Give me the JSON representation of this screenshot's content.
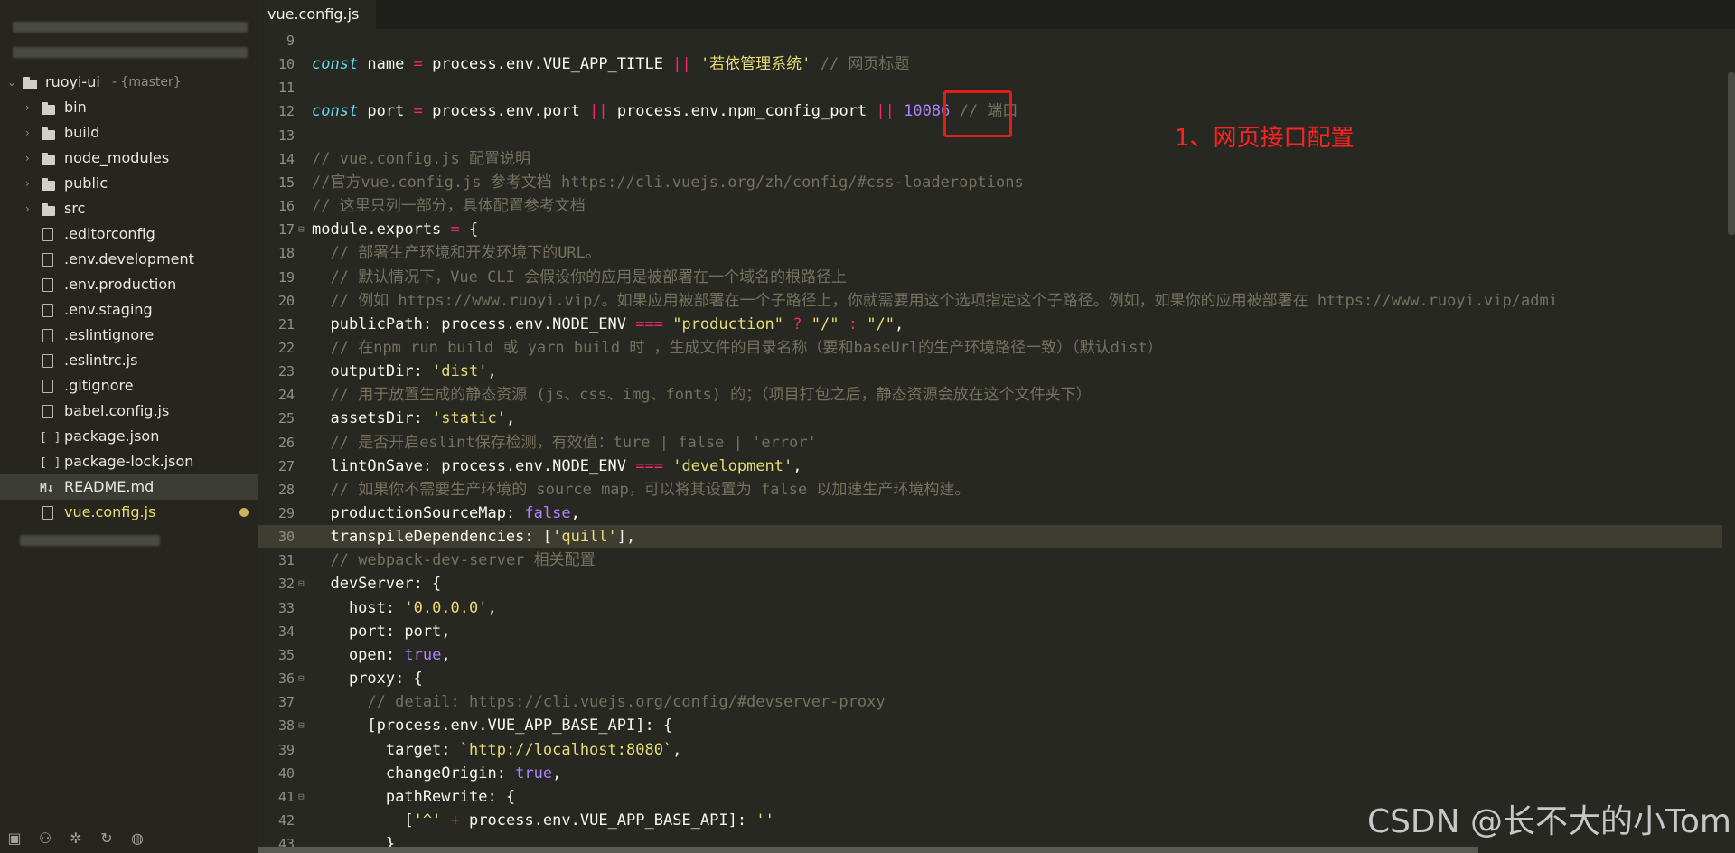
{
  "sidebar": {
    "project": {
      "name": "ruoyi-ui",
      "branch": "- {master}"
    },
    "items": [
      {
        "type": "folder",
        "label": "bin"
      },
      {
        "type": "folder",
        "label": "build"
      },
      {
        "type": "folder",
        "label": "node_modules"
      },
      {
        "type": "folder",
        "label": "public"
      },
      {
        "type": "folder",
        "label": "src"
      },
      {
        "type": "file",
        "label": ".editorconfig"
      },
      {
        "type": "file",
        "label": ".env.development"
      },
      {
        "type": "file",
        "label": ".env.production"
      },
      {
        "type": "file",
        "label": ".env.staging"
      },
      {
        "type": "file",
        "label": ".eslintignore"
      },
      {
        "type": "js",
        "label": ".eslintrc.js"
      },
      {
        "type": "file",
        "label": ".gitignore"
      },
      {
        "type": "js",
        "label": "babel.config.js"
      },
      {
        "type": "json",
        "label": "package.json"
      },
      {
        "type": "json",
        "label": "package-lock.json"
      },
      {
        "type": "md",
        "label": "README.md"
      },
      {
        "type": "js",
        "label": "vue.config.js"
      }
    ]
  },
  "tabs": [
    {
      "label": "vue.config.js"
    }
  ],
  "editor": {
    "lines": [
      {
        "n": "9",
        "html": ""
      },
      {
        "n": "10",
        "html": "<span class='kw'>const</span> name <span class='op'>=</span> process.env.VUE_APP_TITLE <span class='op'>||</span> <span class='str'>'若依管理系统'</span> <span class='cm'>// 网页标题</span>"
      },
      {
        "n": "11",
        "html": ""
      },
      {
        "n": "12",
        "html": "<span class='kw'>const</span> port <span class='op'>=</span> process.env.port <span class='op'>||</span> process.env.npm_config_port <span class='op'>||</span> <span class='num'>10086</span> <span class='cm'>// 端口</span>"
      },
      {
        "n": "13",
        "html": ""
      },
      {
        "n": "14",
        "html": "<span class='cm'>// vue.config.js 配置说明</span>"
      },
      {
        "n": "15",
        "html": "<span class='cm'>//官方vue.config.js 参考文档 https://cli.vuejs.org/zh/config/#css-loaderoptions</span>"
      },
      {
        "n": "16",
        "html": "<span class='cm'>// 这里只列一部分，具体配置参考文档</span>"
      },
      {
        "n": "17",
        "fold": true,
        "html": "module.exports <span class='op'>=</span> {"
      },
      {
        "n": "18",
        "html": "  <span class='cm'>// 部署生产环境和开发环境下的URL。</span>"
      },
      {
        "n": "19",
        "html": "  <span class='cm'>// 默认情况下，Vue CLI 会假设你的应用是被部署在一个域名的根路径上</span>"
      },
      {
        "n": "20",
        "html": "  <span class='cm'>// 例如 https://www.ruoyi.vip/。如果应用被部署在一个子路径上，你就需要用这个选项指定这个子路径。例如，如果你的应用被部署在 https://www.ruoyi.vip/admi</span>"
      },
      {
        "n": "21",
        "html": "  publicPath: process.env.NODE_ENV <span class='op'>===</span> <span class='str'>\"production\"</span> <span class='op'>?</span> <span class='str'>\"/\"</span> <span class='op'>:</span> <span class='str'>\"/\"</span>,"
      },
      {
        "n": "22",
        "html": "  <span class='cm'>// 在npm run build 或 yarn build 时 ，生成文件的目录名称（要和baseUrl的生产环境路径一致）（默认dist）</span>"
      },
      {
        "n": "23",
        "html": "  outputDir: <span class='str'>'dist'</span>,"
      },
      {
        "n": "24",
        "html": "  <span class='cm'>// 用于放置生成的静态资源 (js、css、img、fonts) 的；（项目打包之后，静态资源会放在这个文件夹下）</span>"
      },
      {
        "n": "25",
        "html": "  assetsDir: <span class='str'>'static'</span>,"
      },
      {
        "n": "26",
        "html": "  <span class='cm'>// 是否开启eslint保存检测，有效值：ture | false | 'error'</span>"
      },
      {
        "n": "27",
        "html": "  lintOnSave: process.env.NODE_ENV <span class='op'>===</span> <span class='str'>'development'</span>,"
      },
      {
        "n": "28",
        "html": "  <span class='cm'>// 如果你不需要生产环境的 source map，可以将其设置为 false 以加速生产环境构建。</span>"
      },
      {
        "n": "29",
        "html": "  productionSourceMap: <span class='bool'>false</span>,"
      },
      {
        "n": "30",
        "hl": true,
        "html": "  transpileDependencies: [<span class='str'>'quill'</span>],"
      },
      {
        "n": "31",
        "html": "  <span class='cm'>// webpack-dev-server 相关配置</span>"
      },
      {
        "n": "32",
        "fold": true,
        "html": "  devServer: {"
      },
      {
        "n": "33",
        "html": "    host: <span class='str'>'0.0.0.0'</span>,"
      },
      {
        "n": "34",
        "html": "    port: port,"
      },
      {
        "n": "35",
        "html": "    open: <span class='bool'>true</span>,"
      },
      {
        "n": "36",
        "fold": true,
        "html": "    proxy: {"
      },
      {
        "n": "37",
        "html": "      <span class='cm'>// detail: https://cli.vuejs.org/config/#devserver-proxy</span>"
      },
      {
        "n": "38",
        "fold": true,
        "html": "      [process.env.VUE_APP_BASE_API]: {"
      },
      {
        "n": "39",
        "html": "        target: <span class='str'>`http://localhost:8080`</span>,"
      },
      {
        "n": "40",
        "html": "        changeOrigin: <span class='bool'>true</span>,"
      },
      {
        "n": "41",
        "fold": true,
        "html": "        pathRewrite: {"
      },
      {
        "n": "42",
        "html": "          [<span class='str'>'^'</span> <span class='op'>+</span> process.env.VUE_APP_BASE_API]: <span class='str'>''</span>"
      },
      {
        "n": "43",
        "html": "        }"
      }
    ]
  },
  "annotation": {
    "text": "1、网页接口配置"
  },
  "watermark": "CSDN @长不大的小Tom"
}
